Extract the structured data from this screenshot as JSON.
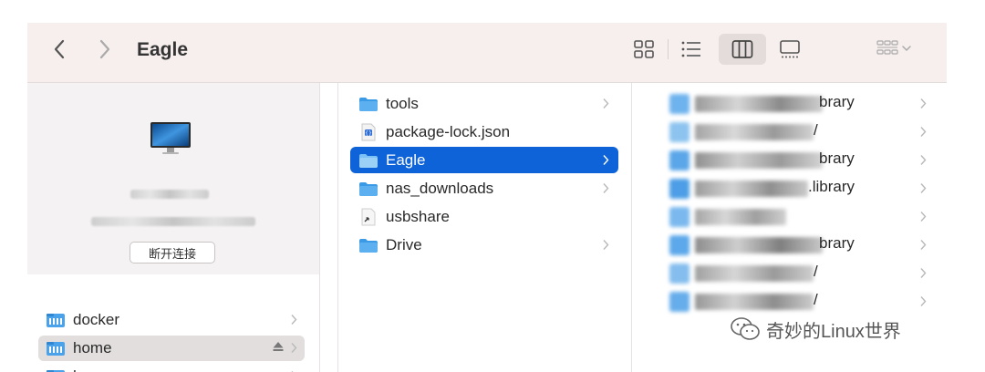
{
  "toolbar": {
    "title": "Eagle",
    "back_icon": "chevron-left-icon",
    "forward_icon": "chevron-right-icon",
    "view_icons": [
      "grid-view-icon",
      "list-view-icon",
      "column-view-icon",
      "gallery-view-icon"
    ],
    "active_view": "column-view-icon",
    "group_icon": "group-by-icon"
  },
  "sidebar": {
    "device": {
      "icon": "imac-icon",
      "disconnect_label": "断开连接"
    },
    "items": [
      {
        "label": "docker",
        "icon": "shared-folder-icon",
        "selected": false
      },
      {
        "label": "home",
        "icon": "shared-folder-icon",
        "selected": true,
        "eject": true
      },
      {
        "label": "homes",
        "icon": "shared-folder-icon",
        "selected": false
      }
    ]
  },
  "column1": {
    "items": [
      {
        "label": "tools",
        "icon": "folder-icon",
        "has_children": true,
        "selected": false
      },
      {
        "label": "package-lock.json",
        "icon": "json-file-icon",
        "has_children": false,
        "selected": false
      },
      {
        "label": "Eagle",
        "icon": "folder-icon",
        "has_children": true,
        "selected": true
      },
      {
        "label": "nas_downloads",
        "icon": "folder-icon",
        "has_children": true,
        "selected": false
      },
      {
        "label": "usbshare",
        "icon": "alias-file-icon",
        "has_children": false,
        "selected": false
      },
      {
        "label": "Drive",
        "icon": "folder-icon",
        "has_children": true,
        "selected": false
      }
    ]
  },
  "column2": {
    "items": [
      {
        "visible_suffix": "brary"
      },
      {
        "visible_suffix": "/"
      },
      {
        "visible_suffix": "brary"
      },
      {
        "visible_suffix": ".library"
      },
      {
        "visible_suffix": ""
      },
      {
        "visible_suffix": "brary"
      },
      {
        "visible_suffix": "/"
      },
      {
        "visible_suffix": "/"
      }
    ]
  },
  "watermark": {
    "text": "奇妙的Linux世界",
    "icon": "wechat-icon"
  },
  "colors": {
    "toolbar_bg": "#f6efed",
    "selection_blue": "#0e63d8",
    "folder_blue": "#3b9ae6",
    "sidebar_selected": "#e2dedd"
  }
}
